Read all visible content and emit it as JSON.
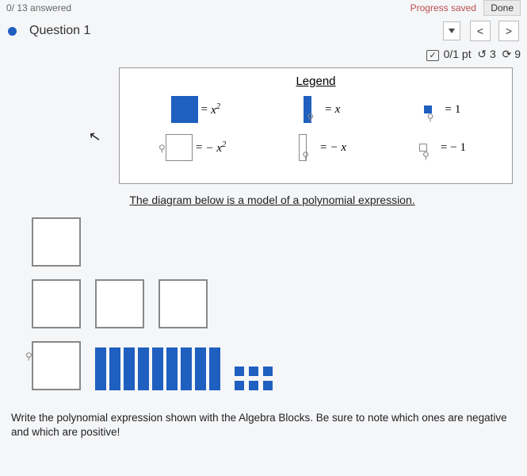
{
  "top": {
    "answered_text": "0/ 13 answered",
    "progress_text": "Progress saved",
    "done_label": "Done"
  },
  "header": {
    "question_label": "Question 1",
    "prev_symbol": "<",
    "next_symbol": ">"
  },
  "score": {
    "points": "0/1 pt",
    "retry_icon": "↺",
    "retry_count": "3",
    "cycle_icon": "⟳",
    "cycle_count": "9"
  },
  "legend": {
    "title": "Legend",
    "x2": "x",
    "x2_exp": "2",
    "x": "x",
    "one": "1",
    "neg_x2_pre": "− ",
    "neg_x2": "x",
    "neg_x2_exp": "2",
    "neg_x": "− x",
    "neg_one": "− 1",
    "eq": "="
  },
  "subtitle": "The diagram below is a model of a polynomial expression.",
  "prompt": "Write the polynomial expression shown with the Algebra Blocks. Be sure to note which ones are negative and which are positive!",
  "chart_data": {
    "type": "table",
    "title": "Algebra tile model",
    "legend_map": {
      "filled_large_square": "x^2",
      "outline_large_square": "-x^2",
      "filled_bar": "x",
      "outline_bar": "-x",
      "filled_unit": "1",
      "outline_unit": "-1"
    },
    "tiles_shown": {
      "outline_large_square": 5,
      "filled_large_square": 0,
      "filled_bar": 9,
      "outline_bar": 0,
      "filled_unit": 6,
      "outline_unit": 0
    },
    "implied_polynomial": "-5x^2 + 9x + 6"
  }
}
